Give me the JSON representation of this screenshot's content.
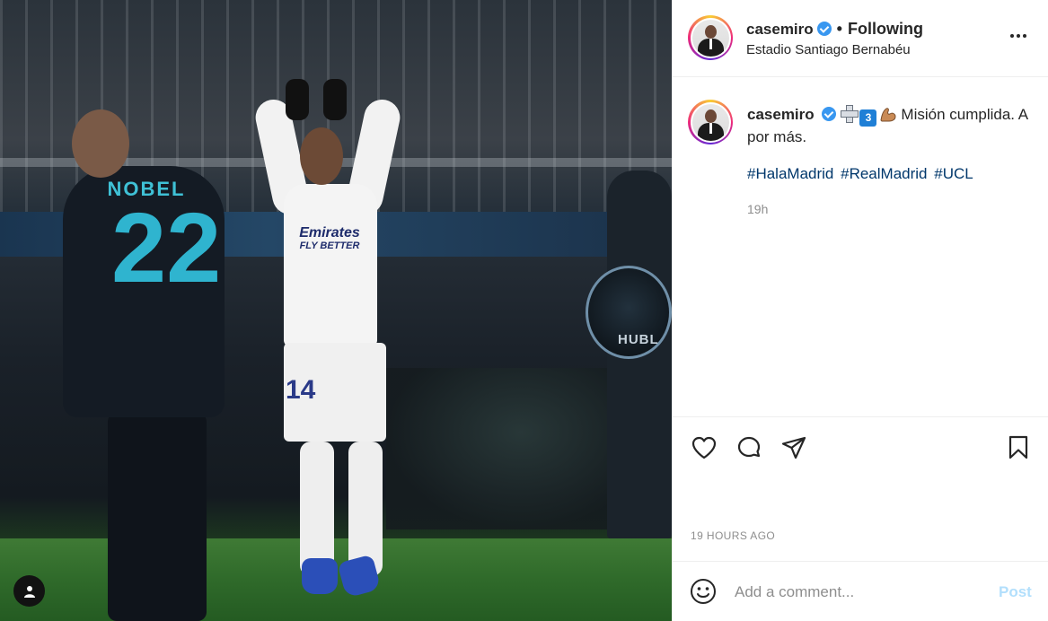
{
  "post": {
    "photo_jersey_name": "NOBEL",
    "photo_jersey_number": "22",
    "photo_sponsor_line1": "Emirates",
    "photo_sponsor_line2": "FLY BETTER",
    "photo_shorts_number": "14",
    "photo_sign_text": "HUBL"
  },
  "header": {
    "username": "casemiro",
    "separator": "•",
    "follow_status": "Following",
    "location": "Estadio Santiago Bernabéu"
  },
  "caption": {
    "username": "casemiro",
    "text": "Misión cumplida. A por más.",
    "emoji_badge": "3",
    "hashtags": [
      "#HalaMadrid",
      "#RealMadrid",
      "#UCL"
    ],
    "time": "19h"
  },
  "footer": {
    "timestamp": "19 HOURS AGO",
    "comment_placeholder": "Add a comment...",
    "post_label": "Post"
  },
  "icons": {
    "like": "heart-icon",
    "comment": "comment-icon",
    "share": "paper-plane-icon",
    "save": "bookmark-icon",
    "emoji": "smiley-icon",
    "more": "ellipsis-icon",
    "tag": "user-tag-icon",
    "verified": "verified-badge-icon"
  },
  "colors": {
    "verified": "#3897f0",
    "hashtag": "#00376b",
    "post_button_disabled": "#b2dffc",
    "muted_text": "#8e8e8e"
  }
}
